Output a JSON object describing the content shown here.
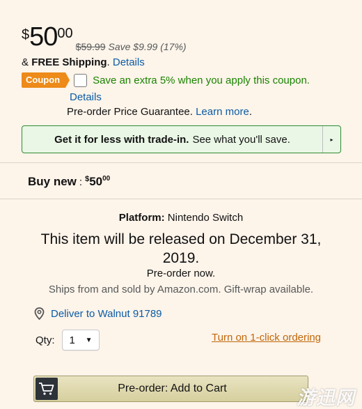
{
  "price": {
    "currency": "$",
    "whole": "50",
    "fraction": "00",
    "list_price": "$59.99",
    "savings": "Save $9.99 (17%)"
  },
  "shipping": {
    "prefix": "& ",
    "free_label": "FREE Shipping",
    "suffix": ".",
    "details_link": "Details"
  },
  "coupon": {
    "badge": "Coupon",
    "text": "Save an extra 5% when you apply this coupon.",
    "details_link": "Details",
    "checked": false
  },
  "guarantee": {
    "text": "Pre-order Price Guarantee. ",
    "link": "Learn more",
    "suffix": "."
  },
  "tradein": {
    "bold": "Get it for less with trade-in.",
    "rest": "See what you'll save."
  },
  "buy_new": {
    "label": "Buy new",
    "colon": ":",
    "currency": "$",
    "whole": "50",
    "fraction": "00"
  },
  "platform": {
    "label": "Platform:",
    "value": "Nintendo Switch"
  },
  "release_text": "This item will be released on December 31, 2019.",
  "preorder_now": "Pre-order now.",
  "ships_text": "Ships from and sold by Amazon.com. Gift-wrap available.",
  "deliver": {
    "text": "Deliver to Walnut 91789",
    "icon": "location-pin-icon"
  },
  "quantity": {
    "label": "Qty:",
    "value": "1"
  },
  "one_click_link": "Turn on 1-click ordering",
  "cart_button": {
    "label": "Pre-order: Add to Cart",
    "icon": "cart-icon"
  },
  "watermark": "游迅网",
  "colors": {
    "link": "#0b5ba5",
    "coupon_badge": "#ed8a19",
    "coupon_text": "#1a8300",
    "oneclick": "#c16709",
    "background": "#fdf4ea"
  }
}
